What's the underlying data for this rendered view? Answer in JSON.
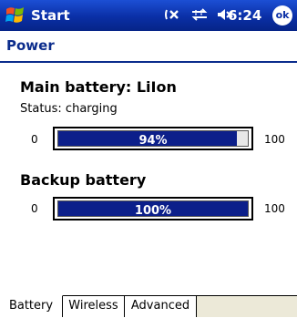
{
  "titlebar": {
    "start_label": "Start",
    "clock": "6:24",
    "ok_label": "ok",
    "icons": [
      "windows-flag-icon",
      "connectivity-icon",
      "signal-icon",
      "speaker-icon"
    ]
  },
  "page": {
    "title": "Power"
  },
  "main_battery": {
    "title": "Main battery: LiIon",
    "status": "Status: charging",
    "min": "0",
    "max": "100",
    "percent": 0.94,
    "percent_label": "94%"
  },
  "backup_battery": {
    "title": "Backup battery",
    "min": "0",
    "max": "100",
    "percent": 1.0,
    "percent_label": "100%"
  },
  "tabs": [
    {
      "label": "Battery",
      "active": true
    },
    {
      "label": "Wireless",
      "active": false
    },
    {
      "label": "Advanced",
      "active": false
    }
  ],
  "colors": {
    "titlebar": "#0a2fa6",
    "heading": "#0b2c8c",
    "bar_fill": "#0c1f8a"
  }
}
